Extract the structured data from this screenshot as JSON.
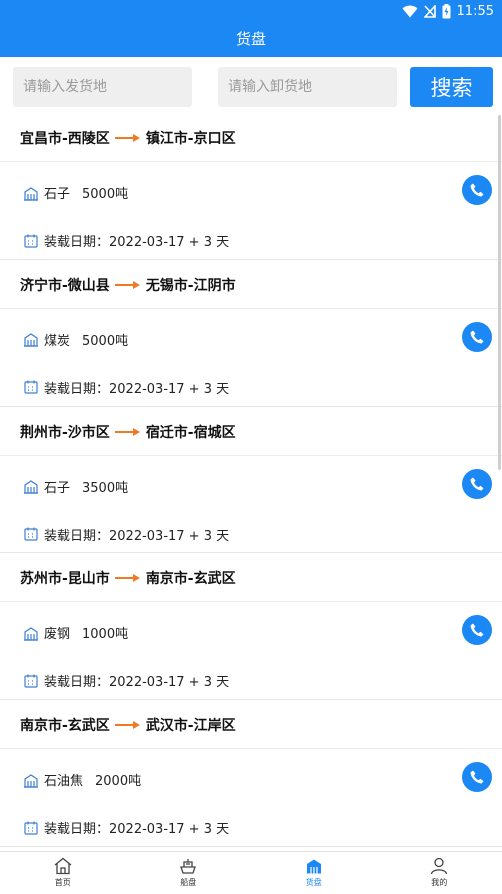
{
  "status_bar": {
    "time": "11:55"
  },
  "header": {
    "title": "货盘"
  },
  "search": {
    "from_placeholder": "请输入发货地",
    "to_placeholder": "请输入卸货地",
    "button_label": "搜索"
  },
  "listings": [
    {
      "from": "宜昌市-西陵区",
      "to": "镇江市-京口区",
      "cargo": "石子",
      "amount": "5000吨",
      "date": "装载日期：2022-03-17 + 3 天"
    },
    {
      "from": "济宁市-微山县",
      "to": "无锡市-江阴市",
      "cargo": "煤炭",
      "amount": "5000吨",
      "date": "装载日期：2022-03-17 + 3 天"
    },
    {
      "from": "荆州市-沙市区",
      "to": "宿迁市-宿城区",
      "cargo": "石子",
      "amount": "3500吨",
      "date": "装载日期：2022-03-17 + 3 天"
    },
    {
      "from": "苏州市-昆山市",
      "to": "南京市-玄武区",
      "cargo": "废钢",
      "amount": "1000吨",
      "date": "装载日期：2022-03-17 + 3 天"
    },
    {
      "from": "南京市-玄武区",
      "to": "武汉市-江岸区",
      "cargo": "石油焦",
      "amount": "2000吨",
      "date": "装载日期：2022-03-17 + 3 天"
    }
  ],
  "tabbar": {
    "items": [
      {
        "label": "首页",
        "icon": "home-icon"
      },
      {
        "label": "船盘",
        "icon": "ship-icon"
      },
      {
        "label": "货盘",
        "icon": "cargo-icon",
        "active": true
      },
      {
        "label": "我的",
        "icon": "user-icon"
      }
    ]
  },
  "colors": {
    "primary": "#1b88f3",
    "arrow": "#f07a23"
  }
}
